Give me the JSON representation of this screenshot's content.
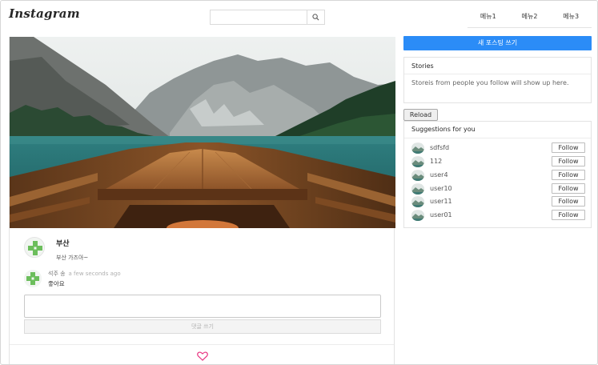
{
  "header": {
    "logo": "Instagram",
    "search": {
      "value": "",
      "placeholder": "",
      "icon": "search-icon"
    },
    "menu": [
      "메뉴1",
      "메뉴2",
      "메뉴3"
    ]
  },
  "post": {
    "author": "부산",
    "caption": "부산 가즈아~",
    "comments": [
      {
        "user": "석주 송",
        "time": "a few seconds ago",
        "text": "좋아요"
      }
    ],
    "comment_input": {
      "value": "",
      "placeholder": ""
    },
    "comment_submit": "댓글 쓰기",
    "like_icon": "heart-icon",
    "like_color": "#e8317f"
  },
  "sidebar": {
    "new_post": "새 포스팅 쓰기",
    "accent": "#2b8cf7",
    "stories": {
      "title": "Stories",
      "body": "Storeis from people you follow will show up here."
    },
    "reload": "Reload",
    "suggestions": {
      "title": "Suggestions for you",
      "follow_label": "Follow",
      "users": [
        "sdfsfd",
        "112",
        "user4",
        "user10",
        "user11",
        "user01"
      ]
    }
  }
}
